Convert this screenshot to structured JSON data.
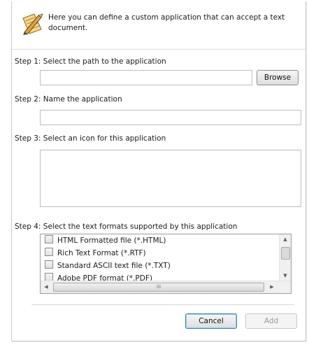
{
  "header": {
    "description": "Here you can define a custom application that can accept a text document."
  },
  "steps": {
    "step1_label": "Step 1: Select the path to the application",
    "path_value": "",
    "browse_label": "Browse",
    "step2_label": "Step 2: Name the application",
    "name_value": "",
    "step3_label": "Step 3: Select an icon for this application",
    "step4_label": "Step 4: Select the text formats supported by this application"
  },
  "formats": [
    {
      "label": "HTML Formatted file (*.HTML)",
      "checked": false
    },
    {
      "label": "Rich Text Format (*.RTF)",
      "checked": false
    },
    {
      "label": "Standard ASCII text file (*.TXT)",
      "checked": false
    },
    {
      "label": "Adobe PDF format (*.PDF)",
      "checked": false
    }
  ],
  "scroll_thumb_glyph": "III",
  "footer": {
    "cancel_label": "Cancel",
    "add_label": "Add"
  },
  "icons": {
    "header": "notepad-pencil-icon"
  }
}
